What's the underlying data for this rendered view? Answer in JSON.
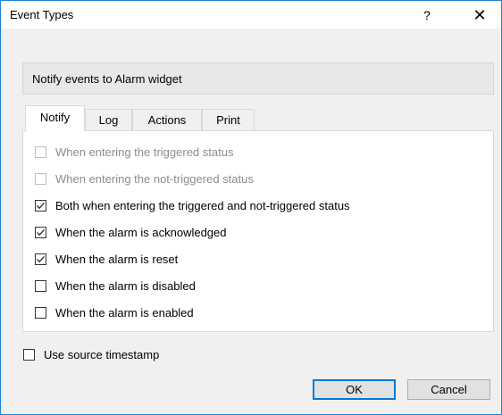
{
  "window": {
    "title": "Event Types",
    "help_label": "?",
    "close_label": "✕"
  },
  "banner": {
    "text": "Notify events to Alarm widget"
  },
  "tabs": [
    {
      "label": "Notify",
      "active": true
    },
    {
      "label": "Log",
      "active": false
    },
    {
      "label": "Actions",
      "active": false
    },
    {
      "label": "Print",
      "active": false
    }
  ],
  "notify_options": [
    {
      "label": "When entering the triggered status",
      "checked": false,
      "enabled": false
    },
    {
      "label": "When entering the not-triggered status",
      "checked": false,
      "enabled": false
    },
    {
      "label": "Both when entering the triggered and not-triggered status",
      "checked": true,
      "enabled": true
    },
    {
      "label": "When the alarm is acknowledged",
      "checked": true,
      "enabled": true
    },
    {
      "label": "When the alarm is reset",
      "checked": true,
      "enabled": true
    },
    {
      "label": "When the alarm is disabled",
      "checked": false,
      "enabled": true
    },
    {
      "label": "When the alarm is enabled",
      "checked": false,
      "enabled": true
    }
  ],
  "source_timestamp": {
    "label": "Use source timestamp",
    "checked": false
  },
  "buttons": {
    "ok_label": "OK",
    "cancel_label": "Cancel"
  },
  "colors": {
    "window_border": "#1883d7",
    "default_button_border": "#0078d7",
    "disabled_text": "#8d8d8d"
  }
}
